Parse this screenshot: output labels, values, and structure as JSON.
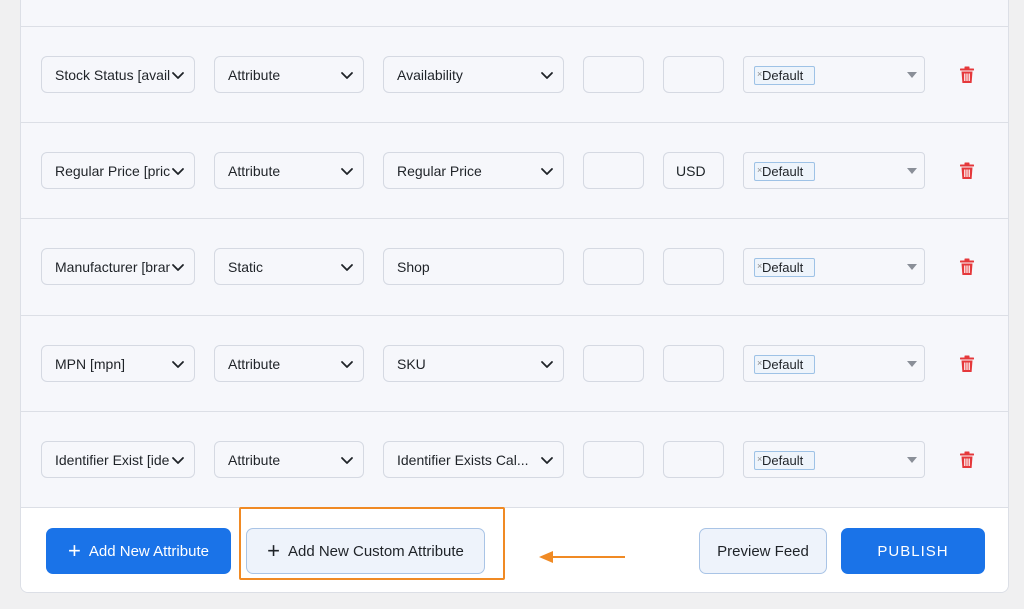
{
  "rows": [
    {
      "attr": "Stock Status [availa",
      "type": "Attribute",
      "value": "Availability",
      "value_select": true,
      "prefix": "",
      "suffix": "",
      "modifier": "Default"
    },
    {
      "attr": "Regular Price [price",
      "type": "Attribute",
      "value": "Regular Price",
      "value_select": true,
      "prefix": "",
      "suffix": "USD",
      "modifier": "Default"
    },
    {
      "attr": "Manufacturer [branc",
      "type": "Static",
      "value": "Shop",
      "value_select": false,
      "prefix": "",
      "suffix": "",
      "modifier": "Default"
    },
    {
      "attr": "MPN [mpn]",
      "type": "Attribute",
      "value": "SKU",
      "value_select": true,
      "prefix": "",
      "suffix": "",
      "modifier": "Default"
    },
    {
      "attr": "Identifier Exist [iden",
      "type": "Attribute",
      "value": "Identifier Exists Cal...",
      "value_select": true,
      "prefix": "",
      "suffix": "",
      "modifier": "Default"
    }
  ],
  "footer": {
    "add_attribute": "Add New Attribute",
    "add_custom": "Add New Custom Attribute",
    "preview": "Preview Feed",
    "publish": "PUBLISH"
  },
  "icons": {
    "plus": "+",
    "remove": "×"
  },
  "colors": {
    "primary": "#1a73e8",
    "delete": "#e5383b",
    "highlight": "#f08a24"
  }
}
